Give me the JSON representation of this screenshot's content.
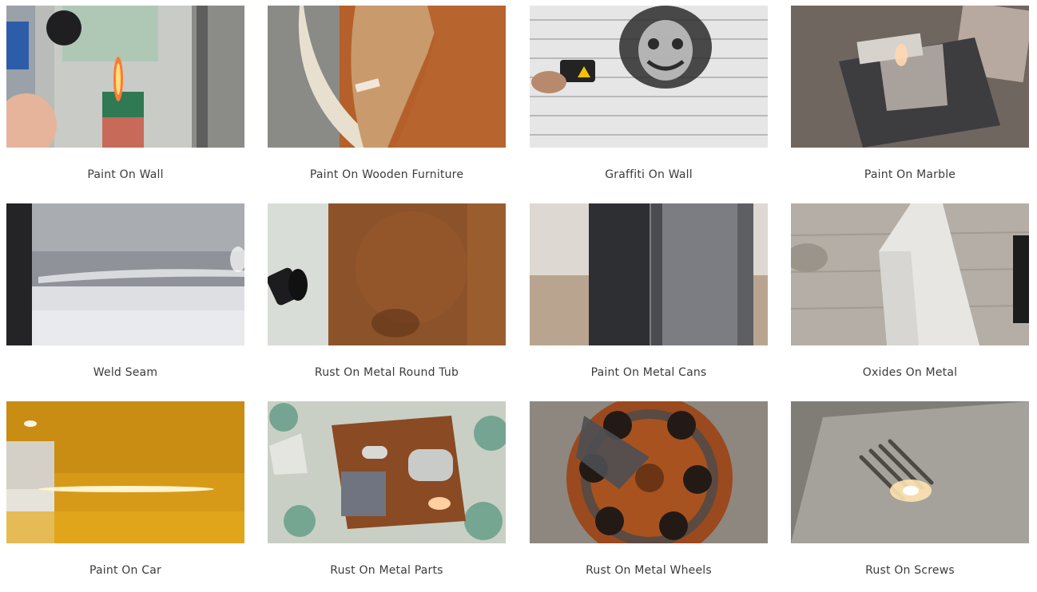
{
  "gallery": {
    "items": [
      {
        "caption": "Paint On Wall",
        "scene": "paint-wall"
      },
      {
        "caption": "Paint On Wooden Furniture",
        "scene": "wood"
      },
      {
        "caption": "Graffiti On Wall",
        "scene": "graffiti"
      },
      {
        "caption": "Paint On Marble",
        "scene": "marble"
      },
      {
        "caption": "Weld Seam",
        "scene": "weld"
      },
      {
        "caption": "Rust On Metal Round Tub",
        "scene": "round-tub"
      },
      {
        "caption": "Paint On Metal Cans",
        "scene": "cans"
      },
      {
        "caption": "Oxides On Metal",
        "scene": "oxides"
      },
      {
        "caption": "Paint On Car",
        "scene": "car"
      },
      {
        "caption": "Rust On Metal Parts",
        "scene": "parts"
      },
      {
        "caption": "Rust On Metal Wheels",
        "scene": "wheels"
      },
      {
        "caption": "Rust On Screws",
        "scene": "screws"
      }
    ]
  }
}
